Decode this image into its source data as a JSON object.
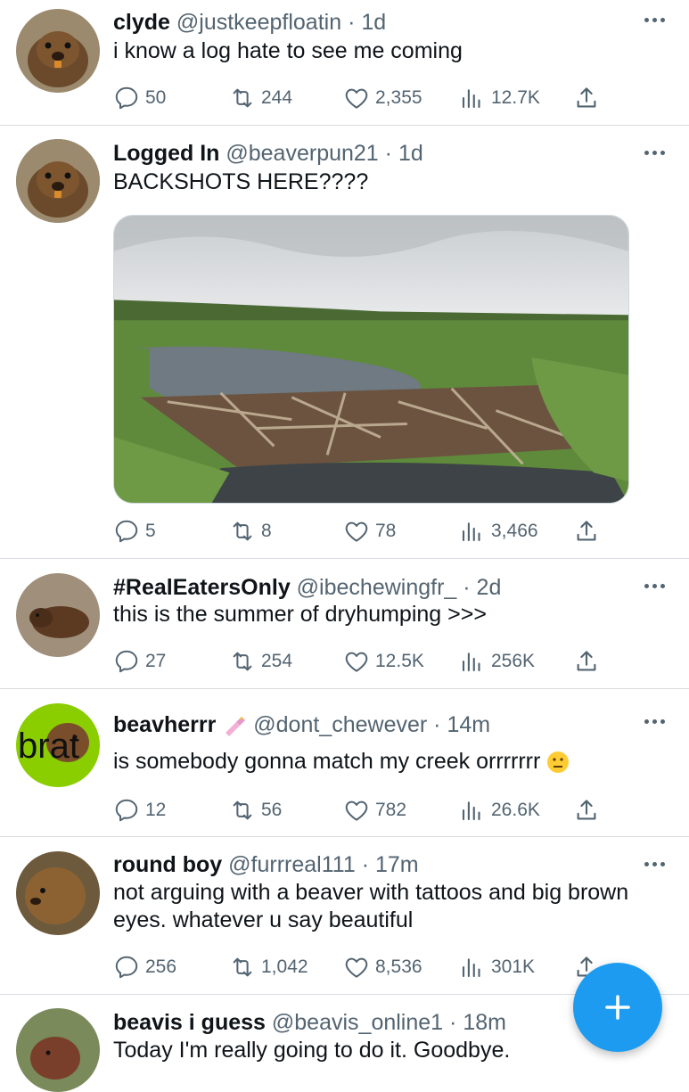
{
  "tweets": [
    {
      "name": "clyde",
      "handle": "@justkeepfloatin",
      "sep": "·",
      "time": "1d",
      "text": "i know a log hate to see me coming",
      "replies": "50",
      "retweets": "244",
      "likes": "2,355",
      "views": "12.7K"
    },
    {
      "name": "Logged In",
      "handle": "@beaverpun21",
      "sep": "·",
      "time": "1d",
      "text": "BACKSHOTS HERE????",
      "replies": "5",
      "retweets": "8",
      "likes": "78",
      "views": "3,466"
    },
    {
      "name": "#RealEatersOnly",
      "handle": "@ibechewingfr_",
      "sep": "·",
      "time": "2d",
      "text": "this is the summer of dryhumping >>>",
      "replies": "27",
      "retweets": "254",
      "likes": "12.5K",
      "views": "256K"
    },
    {
      "name": "beavherrr",
      "handle": "@dont_chewever",
      "sep": "·",
      "time": "14m",
      "text": "is somebody gonna match my creek orrrrrrr",
      "avatar_text": "brat",
      "replies": "12",
      "retweets": "56",
      "likes": "782",
      "views": "26.6K"
    },
    {
      "name": "round boy",
      "handle": "@furrreal111",
      "sep": "·",
      "time": "17m",
      "text": "not arguing with a beaver with tattoos and big brown eyes. whatever u say beautiful",
      "replies": "256",
      "retweets": "1,042",
      "likes": "8,536",
      "views": "301K"
    },
    {
      "name": "beavis i guess",
      "handle": "@beavis_online1",
      "sep": "·",
      "time": "18m",
      "text": "Today I'm really going to do it. Goodbye."
    }
  ],
  "icons": {
    "reply": "reply-icon",
    "retweet": "retweet-icon",
    "like": "heart-icon",
    "views": "views-icon",
    "share": "share-icon",
    "more": "more-options-icon",
    "compose": "plus-icon"
  },
  "colors": {
    "accent": "#1d9bf0",
    "text": "#0f1419",
    "muted": "#536471",
    "divider": "#d9dde1",
    "brat_green": "#8ace00"
  }
}
